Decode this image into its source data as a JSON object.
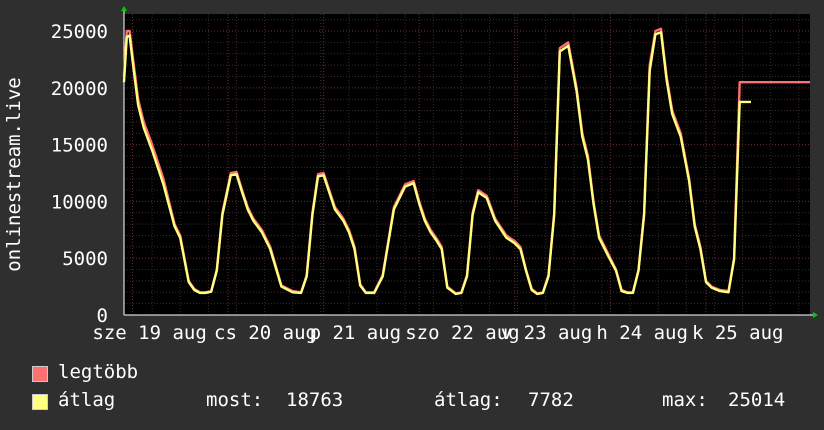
{
  "chart_data": {
    "type": "line",
    "ylabel": "onlinestream.live",
    "ylim": [
      0,
      26500
    ],
    "x_tick_labels": [
      "sze 19 aug",
      "cs 20 aug",
      "p 21 aug",
      "szo 22 aug",
      "v 23 aug",
      "h 24 aug",
      "k 25 aug"
    ],
    "y_ticks": [
      0,
      5000,
      10000,
      15000,
      20000,
      25000
    ],
    "grid": true,
    "series": [
      {
        "name": "legtöbb",
        "color": "#ff7070",
        "x": [
          0,
          0.05,
          0.1,
          0.15,
          0.25,
          0.35,
          0.5,
          0.7,
          0.9,
          1.0,
          1.15,
          1.25,
          1.35,
          1.45,
          1.55,
          1.65,
          1.75,
          1.9,
          2.0,
          2.1,
          2.2,
          2.3,
          2.45,
          2.6,
          2.8,
          3.0,
          3.15,
          3.25,
          3.35,
          3.45,
          3.55,
          3.65,
          3.75,
          3.9,
          4.0,
          4.1,
          4.2,
          4.3,
          4.45,
          4.6,
          4.8,
          5.0,
          5.15,
          5.25,
          5.35,
          5.45,
          5.55,
          5.65,
          5.75,
          5.9,
          6.0,
          6.1,
          6.2,
          6.3,
          6.45,
          6.6,
          6.8,
          6.95,
          7.05,
          7.15,
          7.25,
          7.35,
          7.45,
          7.55,
          7.65,
          7.75,
          7.9,
          8.05,
          8.15,
          8.25,
          8.35,
          8.45,
          8.6,
          8.75,
          8.85,
          8.95,
          9.05,
          9.15,
          9.25,
          9.35,
          9.45,
          9.55,
          9.65,
          9.75,
          9.9,
          10.05,
          10.15,
          10.25,
          10.35,
          10.45,
          10.6,
          10.75,
          10.85,
          10.95,
          11.05,
          11.15,
          11.25,
          11.35,
          11.45,
          11.55,
          11.65,
          11.75,
          11.9,
          12.0,
          12.1,
          12.2
        ],
        "y": [
          21000,
          25000,
          25000,
          23000,
          19000,
          17000,
          15000,
          12000,
          8000,
          7000,
          3000,
          2300,
          2000,
          2000,
          2100,
          4000,
          9000,
          12500,
          12600,
          11000,
          9500,
          8500,
          7500,
          6000,
          2600,
          2100,
          2000,
          3500,
          9000,
          12400,
          12500,
          11000,
          9500,
          8500,
          7500,
          6000,
          2700,
          2000,
          2000,
          3500,
          9500,
          11500,
          11800,
          10000,
          8500,
          7500,
          6800,
          6000,
          2500,
          1900,
          2000,
          3500,
          9000,
          11000,
          10500,
          8500,
          7000,
          6500,
          6000,
          4000,
          2300,
          1900,
          2000,
          3500,
          9000,
          23500,
          24000,
          20000,
          16000,
          14000,
          10000,
          7000,
          5500,
          4000,
          2200,
          2000,
          2000,
          4000,
          9000,
          22000,
          25000,
          25200,
          21000,
          18000,
          16000,
          12000,
          8000,
          6000,
          3000,
          2500,
          2200,
          2100,
          5000,
          20500,
          20500,
          20500,
          20500,
          20500,
          20500,
          20500,
          20500,
          20500,
          20500,
          20500,
          20500,
          20500
        ]
      },
      {
        "name": "átlag",
        "color": "#ffff80",
        "x": [
          0,
          0.05,
          0.1,
          0.15,
          0.25,
          0.35,
          0.5,
          0.7,
          0.9,
          1.0,
          1.15,
          1.25,
          1.35,
          1.45,
          1.55,
          1.65,
          1.75,
          1.9,
          2.0,
          2.1,
          2.2,
          2.3,
          2.45,
          2.6,
          2.8,
          3.0,
          3.15,
          3.25,
          3.35,
          3.45,
          3.55,
          3.65,
          3.75,
          3.9,
          4.0,
          4.1,
          4.2,
          4.3,
          4.45,
          4.6,
          4.8,
          5.0,
          5.15,
          5.25,
          5.35,
          5.45,
          5.55,
          5.65,
          5.75,
          5.9,
          6.0,
          6.1,
          6.2,
          6.3,
          6.45,
          6.6,
          6.8,
          6.95,
          7.05,
          7.15,
          7.25,
          7.35,
          7.45,
          7.55,
          7.65,
          7.75,
          7.9,
          8.05,
          8.15,
          8.25,
          8.35,
          8.45,
          8.6,
          8.75,
          8.85,
          8.95,
          9.05,
          9.15,
          9.25,
          9.35,
          9.45,
          9.55,
          9.65,
          9.75,
          9.9,
          10.05,
          10.15,
          10.25,
          10.35,
          10.45,
          10.6,
          10.75,
          10.85,
          10.95,
          11.05,
          11.15
        ],
        "y": [
          20500,
          24500,
          24600,
          22500,
          18500,
          16500,
          14500,
          11500,
          7800,
          6800,
          2900,
          2200,
          1950,
          1950,
          2050,
          3900,
          8800,
          12300,
          12400,
          10800,
          9300,
          8300,
          7300,
          5800,
          2500,
          2000,
          1950,
          3400,
          8800,
          12200,
          12300,
          10800,
          9300,
          8300,
          7300,
          5800,
          2600,
          1950,
          1950,
          3400,
          9300,
          11300,
          11600,
          9800,
          8300,
          7300,
          6600,
          5800,
          2400,
          1850,
          1950,
          3400,
          8800,
          10800,
          10300,
          8300,
          6800,
          6300,
          5800,
          3900,
          2200,
          1850,
          1950,
          3400,
          8800,
          23200,
          23700,
          19700,
          15700,
          13700,
          9800,
          6800,
          5300,
          3900,
          2100,
          1950,
          1950,
          3900,
          8800,
          21500,
          24700,
          24900,
          20700,
          17700,
          15700,
          11800,
          7800,
          5800,
          2900,
          2400,
          2100,
          2000,
          4900,
          18763,
          18763,
          18763
        ]
      }
    ]
  },
  "legend": {
    "items": [
      {
        "label": "legtöbb",
        "color": "#ff7070"
      },
      {
        "label": "átlag",
        "color": "#ffff80"
      }
    ],
    "stats": [
      {
        "label": "most:",
        "value": "18763"
      },
      {
        "label": "átlag:",
        "value": "7782"
      },
      {
        "label": "max:",
        "value": "25014"
      }
    ]
  }
}
